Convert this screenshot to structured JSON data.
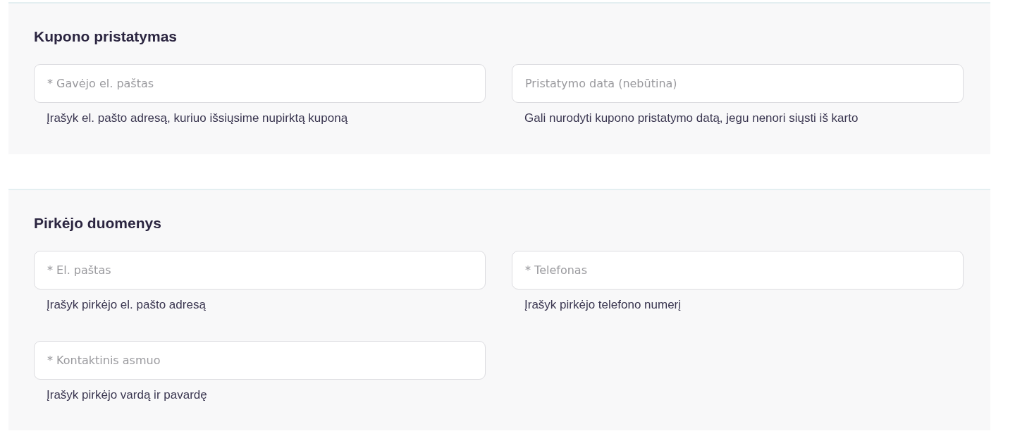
{
  "sections": [
    {
      "title": "Kupono pristatymas",
      "fields": [
        {
          "placeholder": "* Gavėjo el. paštas",
          "helper": "Įrašyk el. pašto adresą, kuriuo išsiųsime nupirktą kuponą"
        },
        {
          "placeholder": "Pristatymo data (nebūtina)",
          "helper": "Gali nurodyti kupono pristatymo datą, jegu nenori siųsti iš karto"
        }
      ]
    },
    {
      "title": "Pirkėjo duomenys",
      "fields": [
        {
          "placeholder": "* El. paštas",
          "helper": "Įrašyk pirkėjo el. pašto adresą"
        },
        {
          "placeholder": "* Telefonas",
          "helper": "Įrašyk pirkėjo telefono numerį"
        },
        {
          "placeholder": "* Kontaktinis asmuo",
          "helper": "Įrašyk pirkėjo vardą ir pavardę"
        }
      ]
    }
  ]
}
